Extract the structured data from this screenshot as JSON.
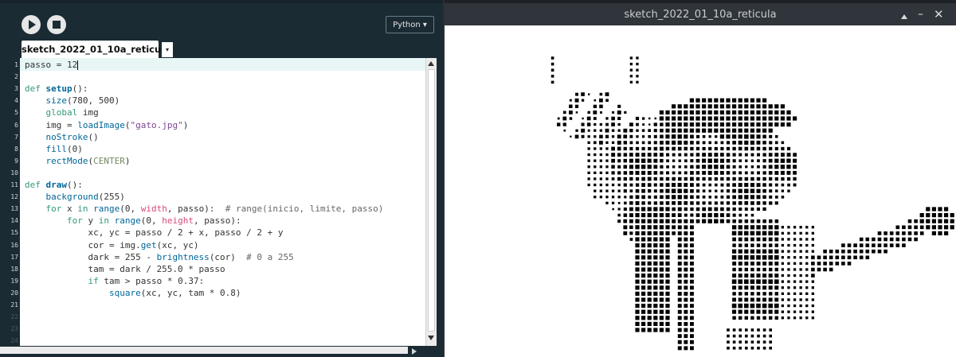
{
  "ide": {
    "run_icon": "play-icon",
    "stop_icon": "stop-icon",
    "mode_label": "Python ▾",
    "tab_label": "sketch_2022_01_10a_reticula",
    "tab_menu_glyph": "▾",
    "line_numbers": [
      "1",
      "2",
      "3",
      "4",
      "5",
      "6",
      "7",
      "8",
      "9",
      "10",
      "11",
      "12",
      "13",
      "14",
      "15",
      "16",
      "17",
      "18",
      "19",
      "20",
      "21",
      "22",
      "23",
      "24"
    ],
    "code_lines": [
      [
        {
          "t": "passo = 12",
          "c": "nm"
        }
      ],
      [],
      [
        {
          "t": "def ",
          "c": "kw"
        },
        {
          "t": "setup",
          "c": "fn"
        },
        {
          "t": "():",
          "c": "nm"
        }
      ],
      [
        {
          "t": "    ",
          "c": "nm"
        },
        {
          "t": "size",
          "c": "bi"
        },
        {
          "t": "(780, 500)",
          "c": "nm"
        }
      ],
      [
        {
          "t": "    ",
          "c": "nm"
        },
        {
          "t": "global",
          "c": "kw"
        },
        {
          "t": " img",
          "c": "nm"
        }
      ],
      [
        {
          "t": "    img = ",
          "c": "nm"
        },
        {
          "t": "loadImage",
          "c": "bi"
        },
        {
          "t": "(",
          "c": "nm"
        },
        {
          "t": "\"gato.jpg\"",
          "c": "str"
        },
        {
          "t": ")",
          "c": "nm"
        }
      ],
      [
        {
          "t": "    ",
          "c": "nm"
        },
        {
          "t": "noStroke",
          "c": "bi"
        },
        {
          "t": "()",
          "c": "nm"
        }
      ],
      [
        {
          "t": "    ",
          "c": "nm"
        },
        {
          "t": "fill",
          "c": "bi"
        },
        {
          "t": "(0)",
          "c": "nm"
        }
      ],
      [
        {
          "t": "    ",
          "c": "nm"
        },
        {
          "t": "rectMode",
          "c": "bi"
        },
        {
          "t": "(",
          "c": "nm"
        },
        {
          "t": "CENTER",
          "c": "con"
        },
        {
          "t": ")",
          "c": "nm"
        }
      ],
      [],
      [
        {
          "t": "def ",
          "c": "kw"
        },
        {
          "t": "draw",
          "c": "fn"
        },
        {
          "t": "():",
          "c": "nm"
        }
      ],
      [
        {
          "t": "    ",
          "c": "nm"
        },
        {
          "t": "background",
          "c": "bi"
        },
        {
          "t": "(255)",
          "c": "nm"
        }
      ],
      [
        {
          "t": "    ",
          "c": "nm"
        },
        {
          "t": "for",
          "c": "kw"
        },
        {
          "t": " x ",
          "c": "nm"
        },
        {
          "t": "in",
          "c": "kw"
        },
        {
          "t": " ",
          "c": "nm"
        },
        {
          "t": "range",
          "c": "bi"
        },
        {
          "t": "(0, ",
          "c": "nm"
        },
        {
          "t": "width",
          "c": "sys"
        },
        {
          "t": ", passo):  ",
          "c": "nm"
        },
        {
          "t": "# range(inicio, limite, passo)",
          "c": "cm"
        }
      ],
      [
        {
          "t": "        ",
          "c": "nm"
        },
        {
          "t": "for",
          "c": "kw"
        },
        {
          "t": " y ",
          "c": "nm"
        },
        {
          "t": "in",
          "c": "kw"
        },
        {
          "t": " ",
          "c": "nm"
        },
        {
          "t": "range",
          "c": "bi"
        },
        {
          "t": "(0, ",
          "c": "nm"
        },
        {
          "t": "height",
          "c": "sys"
        },
        {
          "t": ", passo):",
          "c": "nm"
        }
      ],
      [
        {
          "t": "            xc, yc = passo / 2 + x, passo / 2 + y",
          "c": "nm"
        }
      ],
      [
        {
          "t": "            cor = img.",
          "c": "nm"
        },
        {
          "t": "get",
          "c": "bi"
        },
        {
          "t": "(xc, yc)",
          "c": "nm"
        }
      ],
      [
        {
          "t": "            dark = 255 - ",
          "c": "nm"
        },
        {
          "t": "brightness",
          "c": "bi"
        },
        {
          "t": "(cor)  ",
          "c": "nm"
        },
        {
          "t": "# 0 a 255",
          "c": "cm"
        }
      ],
      [
        {
          "t": "            tam = dark / 255.0 * passo",
          "c": "nm"
        }
      ],
      [
        {
          "t": "            ",
          "c": "nm"
        },
        {
          "t": "if",
          "c": "kw"
        },
        {
          "t": " tam > passo * 0.37:",
          "c": "nm"
        }
      ],
      [
        {
          "t": "                ",
          "c": "nm"
        },
        {
          "t": "square",
          "c": "bi"
        },
        {
          "t": "(xc, yc, tam * 0.8)",
          "c": "nm"
        }
      ],
      [],
      [],
      [],
      []
    ]
  },
  "sketch": {
    "window_title": "sketch_2022_01_10a_reticula",
    "up_icon": "arrow-up-icon",
    "minimize_glyph": "–",
    "close_glyph": "✕",
    "grid_step": 12,
    "max_square_frac": 0.8,
    "threshold_frac": 0.37,
    "ink_color": "#000000",
    "background_color": "#ffffff"
  }
}
